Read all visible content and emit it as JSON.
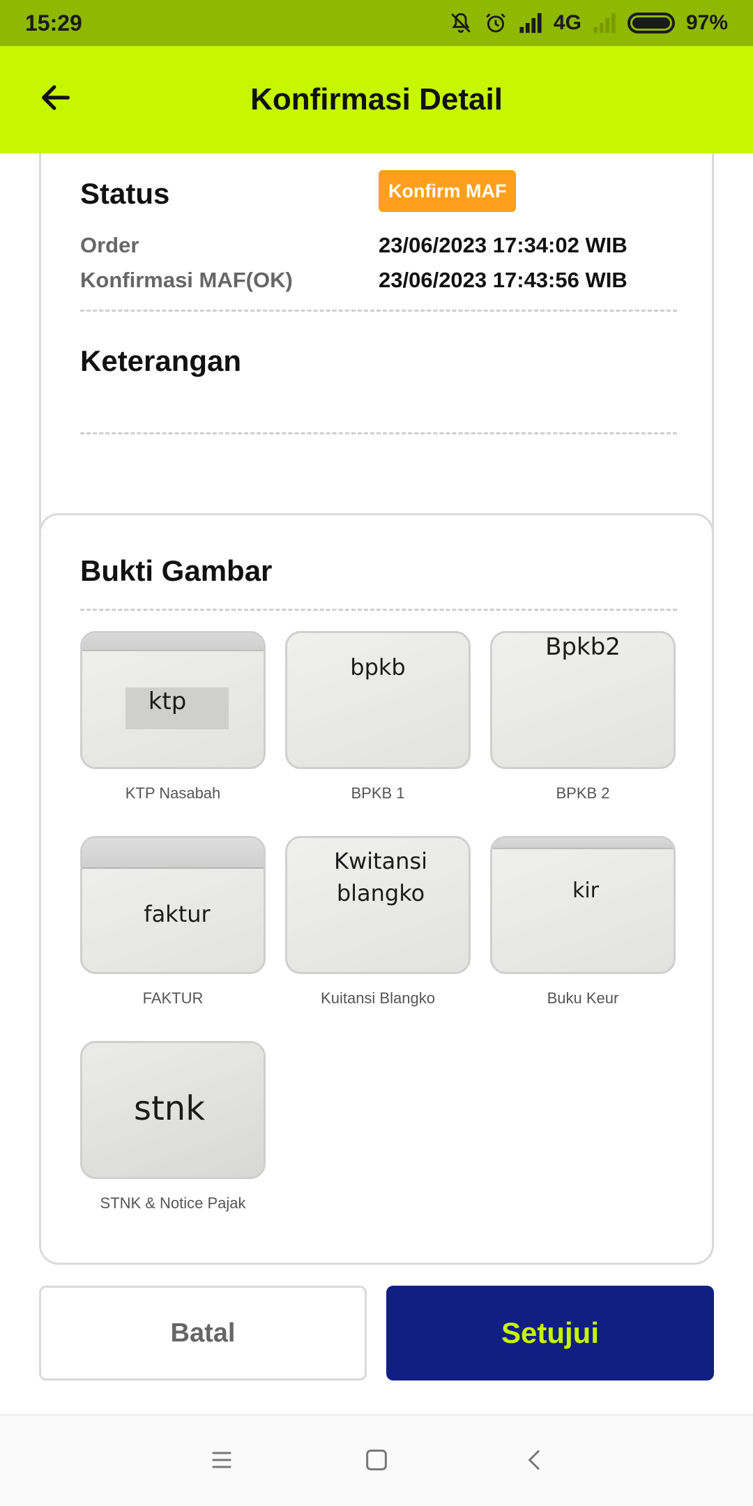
{
  "status_bar": {
    "time": "15:29",
    "network": "4G",
    "battery": "97%",
    "battery_level": 0.97,
    "icons": [
      "mute-bell-icon",
      "alarm-icon",
      "signal-icon",
      "signal-weak-icon",
      "battery-icon"
    ]
  },
  "app_bar": {
    "title": "Konfirmasi Detail",
    "back_icon": "arrow-left-icon"
  },
  "status_section": {
    "label": "Status",
    "badge": "Konfirm MAF",
    "badge_color": "#ff9f1c",
    "rows": [
      {
        "label": "Order",
        "value": "23/06/2023 17:34:02 WIB"
      },
      {
        "label": "Konfirmasi MAF(OK)",
        "value": "23/06/2023 17:43:56 WIB"
      }
    ]
  },
  "keterangan": {
    "label": "Keterangan",
    "value": ""
  },
  "bukti_gambar": {
    "title": "Bukti Gambar",
    "images": [
      {
        "caption": "KTP Nasabah",
        "photo_text": "ktp"
      },
      {
        "caption": "BPKB 1",
        "photo_text": "bpkb"
      },
      {
        "caption": "BPKB 2",
        "photo_text": "Bpkb2"
      },
      {
        "caption": "FAKTUR",
        "photo_text": "faktur"
      },
      {
        "caption": "Kuitansi Blangko",
        "photo_text_line1": "Kwitansi",
        "photo_text_line2": "blangko"
      },
      {
        "caption": "Buku Keur",
        "photo_text": "kir"
      },
      {
        "caption": "STNK & Notice Pajak",
        "photo_text": "stnk"
      }
    ]
  },
  "actions": {
    "cancel": "Batal",
    "approve": "Setujui",
    "approve_bg": "#121f82",
    "approve_fg": "#c6f600"
  },
  "nav_bar": {
    "icons": [
      "menu-icon",
      "home-square-icon",
      "back-chevron-icon"
    ]
  },
  "colors": {
    "status_bar": "#8fb800",
    "app_bar": "#c6f600"
  }
}
